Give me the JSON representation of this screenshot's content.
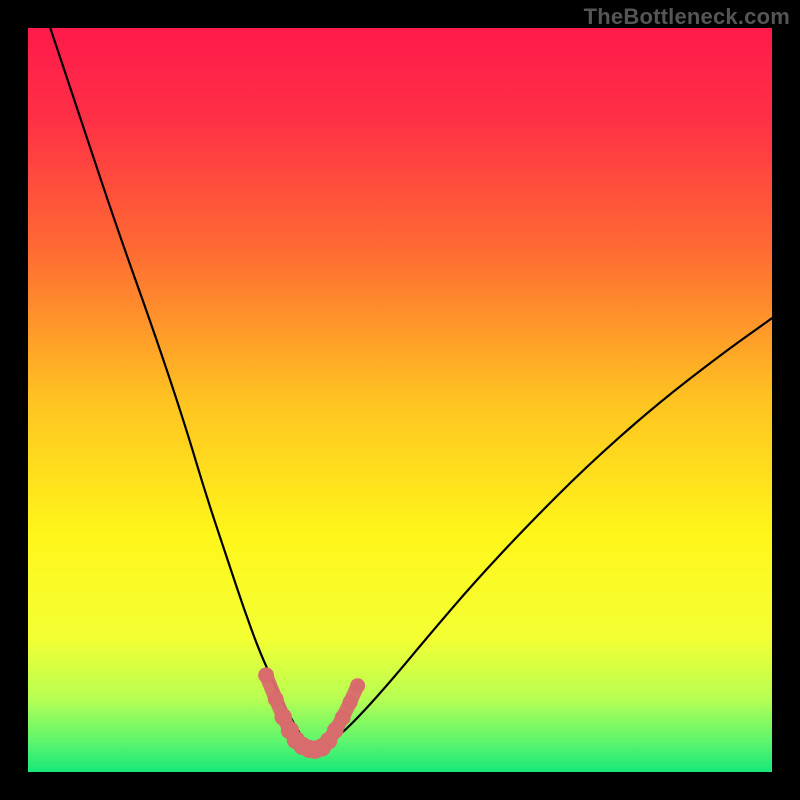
{
  "watermark": "TheBottleneck.com",
  "chart_data": {
    "type": "line",
    "title": "",
    "xlabel": "",
    "ylabel": "",
    "xlim": [
      0,
      100
    ],
    "ylim": [
      0,
      100
    ],
    "gradient_stops": [
      {
        "offset": 0.0,
        "color": "#ff1a4b"
      },
      {
        "offset": 0.12,
        "color": "#ff2f46"
      },
      {
        "offset": 0.3,
        "color": "#ff6b33"
      },
      {
        "offset": 0.5,
        "color": "#ffc321"
      },
      {
        "offset": 0.68,
        "color": "#fff61a"
      },
      {
        "offset": 0.82,
        "color": "#f4ff33"
      },
      {
        "offset": 0.9,
        "color": "#b8ff52"
      },
      {
        "offset": 0.96,
        "color": "#5cf56e"
      },
      {
        "offset": 1.0,
        "color": "#17e87a"
      }
    ],
    "series": [
      {
        "name": "left-branch",
        "x": [
          3,
          7,
          12,
          17,
          21,
          24,
          27,
          29,
          31,
          33,
          34.5,
          35.7,
          36.5,
          37.3,
          38.0,
          38.6
        ],
        "y": [
          100,
          88,
          73,
          59,
          47,
          37,
          28,
          22,
          16.5,
          12,
          8.8,
          6.6,
          5.2,
          4.2,
          3.5,
          3.2
        ]
      },
      {
        "name": "right-branch",
        "x": [
          38.6,
          40.0,
          42.0,
          45.0,
          49.0,
          54.0,
          60.0,
          67.0,
          75.0,
          84.0,
          93.0,
          100.0
        ],
        "y": [
          3.2,
          3.6,
          5.0,
          8.0,
          12.5,
          18.5,
          25.5,
          33.0,
          41.0,
          49.0,
          56.0,
          61.0
        ]
      }
    ],
    "trough_marker": {
      "name": "trough-band",
      "color": "#d86b6b",
      "points": [
        {
          "x": 32.0,
          "y": 13.0,
          "r": 1.2
        },
        {
          "x": 33.3,
          "y": 9.8,
          "r": 1.2
        },
        {
          "x": 34.3,
          "y": 7.4,
          "r": 1.4
        },
        {
          "x": 35.2,
          "y": 5.6,
          "r": 1.5
        },
        {
          "x": 36.0,
          "y": 4.3,
          "r": 1.5
        },
        {
          "x": 36.9,
          "y": 3.5,
          "r": 1.5
        },
        {
          "x": 37.8,
          "y": 3.1,
          "r": 1.5
        },
        {
          "x": 38.6,
          "y": 3.0,
          "r": 1.5
        },
        {
          "x": 39.5,
          "y": 3.3,
          "r": 1.5
        },
        {
          "x": 40.4,
          "y": 4.2,
          "r": 1.4
        },
        {
          "x": 41.3,
          "y": 5.6,
          "r": 1.3
        },
        {
          "x": 42.3,
          "y": 7.3,
          "r": 1.2
        },
        {
          "x": 43.3,
          "y": 9.4,
          "r": 1.1
        },
        {
          "x": 44.3,
          "y": 11.6,
          "r": 1.1
        }
      ]
    }
  }
}
